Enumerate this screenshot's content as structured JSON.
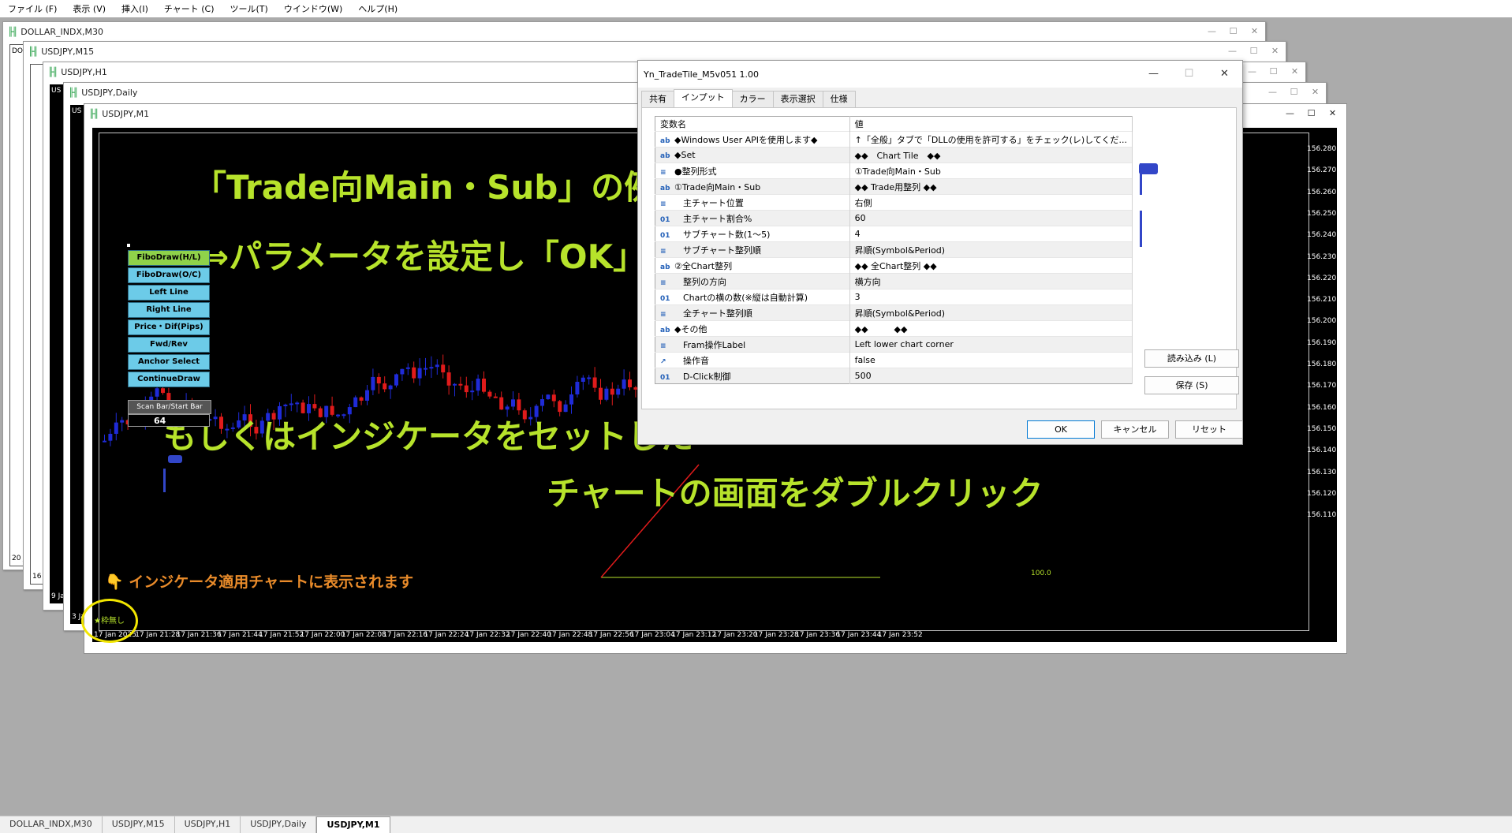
{
  "menu": [
    "ファイル (F)",
    "表示 (V)",
    "挿入(I)",
    "チャート (C)",
    "ツール(T)",
    "ウインドウ(W)",
    "ヘルプ(H)"
  ],
  "windows": {
    "w1": "DOLLAR_INDX,M30",
    "w2": "USDJPY,M15",
    "w3": "USDJPY,H1",
    "w4": "USDJPY,Daily",
    "w5": "USDJPY,M1",
    "w1_side": "DO",
    "w1_side2": "20 J",
    "w2_side2": "16 J",
    "w3_side": "US",
    "w3_side2": "9 Ja",
    "w4_side": "US",
    "w4_side2": "3 Ja"
  },
  "window_controls": [
    "—",
    "☐",
    "✕"
  ],
  "chart": {
    "title": "「Trade向Main・Sub」の例",
    "line2": "⇒パラメータを設定し「OK」",
    "line3": "もしくはインジケータをセットした",
    "line4": "チャートの画面をダブルクリック",
    "note": "👇 インジケータ適用チャートに表示されます",
    "frame_label": "★枠無し",
    "level_label": "100.0",
    "scan_label": "Scan Bar/Start Bar",
    "scan_value": "64",
    "buttons": [
      "FiboDraw(H/L)",
      "FiboDraw(O/C)",
      "Left Line",
      "Right Line",
      "Price・Dif(Pips)",
      "Fwd/Rev",
      "Anchor Select",
      "ContinueDraw"
    ],
    "prices": [
      "156.280",
      "156.270",
      "156.260",
      "156.250",
      "156.240",
      "156.230",
      "156.220",
      "156.210",
      "156.200",
      "156.190",
      "156.180",
      "156.170",
      "156.160",
      "156.150",
      "156.140",
      "156.130",
      "156.120",
      "156.110"
    ],
    "times": [
      "17 Jan 2025",
      "17 Jan 21:28",
      "17 Jan 21:36",
      "17 Jan 21:44",
      "17 Jan 21:52",
      "17 Jan 22:00",
      "17 Jan 22:08",
      "17 Jan 22:16",
      "17 Jan 22:24",
      "17 Jan 22:32",
      "17 Jan 22:40",
      "17 Jan 22:48",
      "17 Jan 22:56",
      "17 Jan 23:04",
      "17 Jan 23:12",
      "17 Jan 23:20",
      "17 Jan 23:28",
      "17 Jan 23:36",
      "17 Jan 23:44",
      "17 Jan 23:52"
    ]
  },
  "dialog": {
    "title": "Yn_TradeTile_M5v051 1.00",
    "tabs": [
      "共有",
      "インプット",
      "カラー",
      "表示選択",
      "仕様"
    ],
    "col_name": "変数名",
    "col_value": "値",
    "rows": [
      {
        "icon": "ab",
        "name": "◆Windows User APIを使用します◆",
        "value": "↑「全般」タブで「DLLの使用を許可する」をチェック(レ)してくだ..."
      },
      {
        "icon": "ab",
        "name": "◆Set",
        "value": "◆◆　Chart Tile　◆◆"
      },
      {
        "icon": "≡",
        "name": "●整列形式",
        "value": "①Trade向Main・Sub"
      },
      {
        "icon": "ab",
        "name": "①Trade向Main・Sub",
        "value": "◆◆ Trade用整列 ◆◆"
      },
      {
        "icon": "≡",
        "name": "　主チャート位置",
        "value": "右側"
      },
      {
        "icon": "01",
        "name": "　主チャート割合%",
        "value": "60"
      },
      {
        "icon": "01",
        "name": "　サブチャート数(1～5)",
        "value": "4"
      },
      {
        "icon": "≡",
        "name": "　サブチャート整列順",
        "value": "昇順(Symbol&Period)"
      },
      {
        "icon": "ab",
        "name": "②全Chart整列",
        "value": "◆◆ 全Chart整列 ◆◆"
      },
      {
        "icon": "≡",
        "name": "　整列の方向",
        "value": "横方向"
      },
      {
        "icon": "01",
        "name": "　Chartの横の数(※縦は自動計算)",
        "value": "3"
      },
      {
        "icon": "≡",
        "name": "　全チャート整列順",
        "value": "昇順(Symbol&Period)"
      },
      {
        "icon": "ab",
        "name": "◆その他",
        "value": "◆◆　　　◆◆"
      },
      {
        "icon": "≡",
        "name": "　Fram操作Label",
        "value": "Left lower chart corner"
      },
      {
        "icon": "↗",
        "name": "　操作音",
        "value": "false"
      },
      {
        "icon": "01",
        "name": "　D-Click制御",
        "value": "500"
      }
    ],
    "load_button": "読み込み (L)",
    "save_button": "保存 (S)",
    "ok_button": "OK",
    "cancel_button": "キャンセル",
    "reset_button": "リセット"
  },
  "taskbar": [
    "DOLLAR_INDX,M30",
    "USDJPY,M15",
    "USDJPY,H1",
    "USDJPY,Daily",
    "USDJPY,M1"
  ],
  "colors": {
    "text_green": "#b7e32b",
    "note_orange": "#e98b2a",
    "bull": "#1f2bd8",
    "bear": "#e01b1b",
    "button_blue": "#6ccbe8",
    "button_green": "#8fd24a",
    "circle": "#f2e600"
  }
}
